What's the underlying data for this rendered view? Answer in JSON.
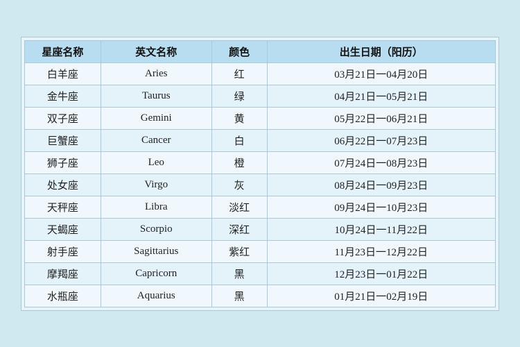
{
  "table": {
    "headers": [
      "星座名称",
      "英文名称",
      "颜色",
      "出生日期（阳历）"
    ],
    "rows": [
      {
        "cn": "白羊座",
        "en": "Aries",
        "color": "红",
        "date": "03月21日一04月20日"
      },
      {
        "cn": "金牛座",
        "en": "Taurus",
        "color": "绿",
        "date": "04月21日一05月21日"
      },
      {
        "cn": "双子座",
        "en": "Gemini",
        "color": "黄",
        "date": "05月22日一06月21日"
      },
      {
        "cn": "巨蟹座",
        "en": "Cancer",
        "color": "白",
        "date": "06月22日一07月23日"
      },
      {
        "cn": "狮子座",
        "en": "Leo",
        "color": "橙",
        "date": "07月24日一08月23日"
      },
      {
        "cn": "处女座",
        "en": "Virgo",
        "color": "灰",
        "date": "08月24日一09月23日"
      },
      {
        "cn": "天秤座",
        "en": "Libra",
        "color": "淡红",
        "date": "09月24日一10月23日"
      },
      {
        "cn": "天蝎座",
        "en": "Scorpio",
        "color": "深红",
        "date": "10月24日一11月22日"
      },
      {
        "cn": "射手座",
        "en": "Sagittarius",
        "color": "紫红",
        "date": "11月23日一12月22日"
      },
      {
        "cn": "摩羯座",
        "en": "Capricorn",
        "color": "黑",
        "date": "12月23日一01月22日"
      },
      {
        "cn": "水瓶座",
        "en": "Aquarius",
        "color": "黑",
        "date": "01月21日一02月19日"
      }
    ]
  }
}
